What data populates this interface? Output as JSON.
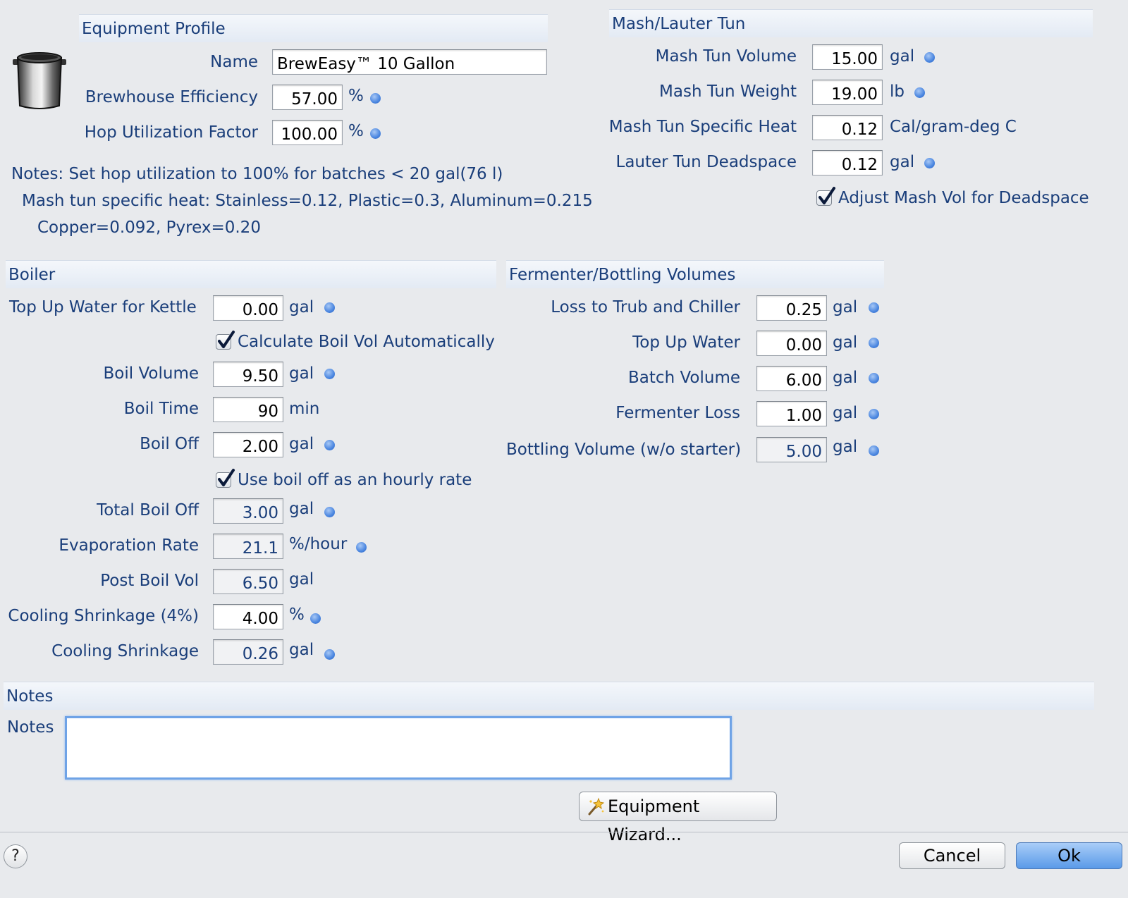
{
  "equipment_profile": {
    "header": "Equipment Profile",
    "name_label": "Name",
    "name_value": "BrewEasy™ 10 Gallon",
    "efficiency_label": "Brewhouse Efficiency",
    "efficiency_value": "57.00",
    "efficiency_unit": "%",
    "hop_label": "Hop Utilization Factor",
    "hop_value": "100.00",
    "hop_unit": "%",
    "note1": "Notes: Set hop utilization to 100% for batches < 20 gal(76 l)",
    "note2": "Mash tun specific heat: Stainless=0.12, Plastic=0.3, Aluminum=0.215",
    "note3": "Copper=0.092, Pyrex=0.20"
  },
  "mash": {
    "header": "Mash/Lauter Tun",
    "volume_label": "Mash Tun Volume",
    "volume_value": "15.00",
    "volume_unit": "gal",
    "weight_label": "Mash Tun Weight",
    "weight_value": "19.00",
    "weight_unit": "lb",
    "heat_label": "Mash Tun Specific Heat",
    "heat_value": "0.12",
    "heat_unit": "Cal/gram-deg C",
    "deadspace_label": "Lauter Tun Deadspace",
    "deadspace_value": "0.12",
    "deadspace_unit": "gal",
    "adjust_label": "Adjust Mash Vol for Deadspace",
    "adjust_checked": true
  },
  "boiler": {
    "header": "Boiler",
    "topup_label": "Top Up Water for Kettle",
    "topup_value": "0.00",
    "topup_unit": "gal",
    "calc_label": "Calculate Boil Vol Automatically",
    "calc_checked": true,
    "boilvol_label": "Boil Volume",
    "boilvol_value": "9.50",
    "boilvol_unit": "gal",
    "boiltime_label": "Boil Time",
    "boiltime_value": "90",
    "boiltime_unit": "min",
    "boiloff_label": "Boil Off",
    "boiloff_value": "2.00",
    "boiloff_unit": "gal",
    "hourly_label": "Use boil off as an hourly rate",
    "hourly_checked": true,
    "total_label": "Total Boil Off",
    "total_value": "3.00",
    "total_unit": "gal",
    "evap_label": "Evaporation Rate",
    "evap_value": "21.1",
    "evap_unit": "%/hour",
    "post_label": "Post Boil Vol",
    "post_value": "6.50",
    "post_unit": "gal",
    "shrinkpct_label": "Cooling Shrinkage (4%)",
    "shrinkpct_value": "4.00",
    "shrinkpct_unit": "%",
    "shrink_label": "Cooling Shrinkage",
    "shrink_value": "0.26",
    "shrink_unit": "gal"
  },
  "fermenter": {
    "header": "Fermenter/Bottling Volumes",
    "trub_label": "Loss to Trub and Chiller",
    "trub_value": "0.25",
    "trub_unit": "gal",
    "topup_label": "Top Up Water",
    "topup_value": "0.00",
    "topup_unit": "gal",
    "batch_label": "Batch Volume",
    "batch_value": "6.00",
    "batch_unit": "gal",
    "loss_label": "Fermenter Loss",
    "loss_value": "1.00",
    "loss_unit": "gal",
    "bottling_label": "Bottling Volume (w/o starter)",
    "bottling_value": "5.00",
    "bottling_unit": "gal"
  },
  "notes": {
    "header": "Notes",
    "label": "Notes",
    "value": ""
  },
  "buttons": {
    "wizard": "Equipment Wizard...",
    "cancel": "Cancel",
    "ok": "Ok",
    "help": "?"
  },
  "colors": {
    "label": "#1a3e7a",
    "accent": "#4a86e0",
    "background": "#e8eaed"
  }
}
